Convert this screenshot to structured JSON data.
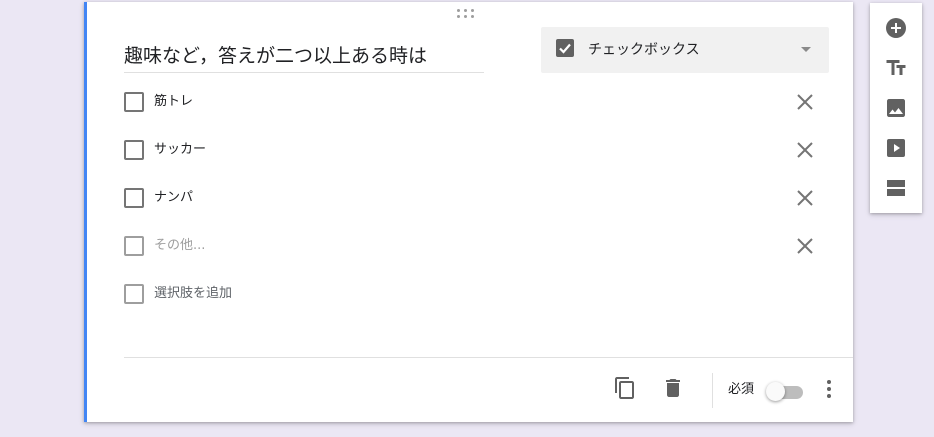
{
  "question": {
    "title": "趣味など，答えが二つ以上ある時は",
    "type_label": "チェックボックス",
    "options": [
      {
        "label": "筋トレ"
      },
      {
        "label": "サッカー"
      },
      {
        "label": "ナンパ"
      }
    ],
    "other_option": "その他...",
    "add_option": "選択肢を追加",
    "required_label": "必須",
    "required_on": false
  },
  "colors": {
    "accent": "#4285f4",
    "icon": "#757575",
    "toolbar_icon": "#616161"
  },
  "toolbar": {
    "icons": [
      "add-circle-icon",
      "title-text-icon",
      "image-icon",
      "video-icon",
      "section-icon"
    ]
  }
}
